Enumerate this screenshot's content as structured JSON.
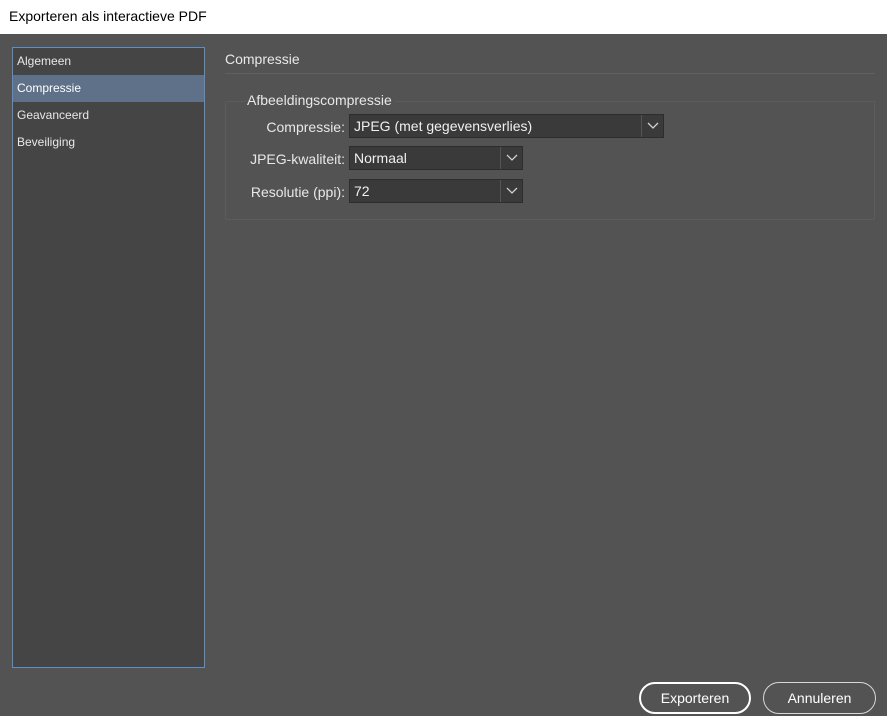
{
  "window": {
    "title": "Exporteren als interactieve PDF"
  },
  "sidebar": {
    "items": [
      {
        "label": "Algemeen",
        "selected": false
      },
      {
        "label": "Compressie",
        "selected": true
      },
      {
        "label": "Geavanceerd",
        "selected": false
      },
      {
        "label": "Beveiliging",
        "selected": false
      }
    ]
  },
  "main": {
    "section_title": "Compressie",
    "group": {
      "title": "Afbeeldingscompressie",
      "compression": {
        "label": "Compressie:",
        "value": "JPEG (met gegevensverlies)"
      },
      "jpeg_quality": {
        "label": "JPEG-kwaliteit:",
        "value": "Normaal"
      },
      "resolution": {
        "label": "Resolutie (ppi):",
        "value": "72"
      }
    }
  },
  "buttons": {
    "export_label": "Exporteren",
    "cancel_label": "Annuleren"
  },
  "colors": {
    "dialog_background": "#535353",
    "selected_item": "#5f7188",
    "sidebar_border": "#5a8fc9"
  }
}
